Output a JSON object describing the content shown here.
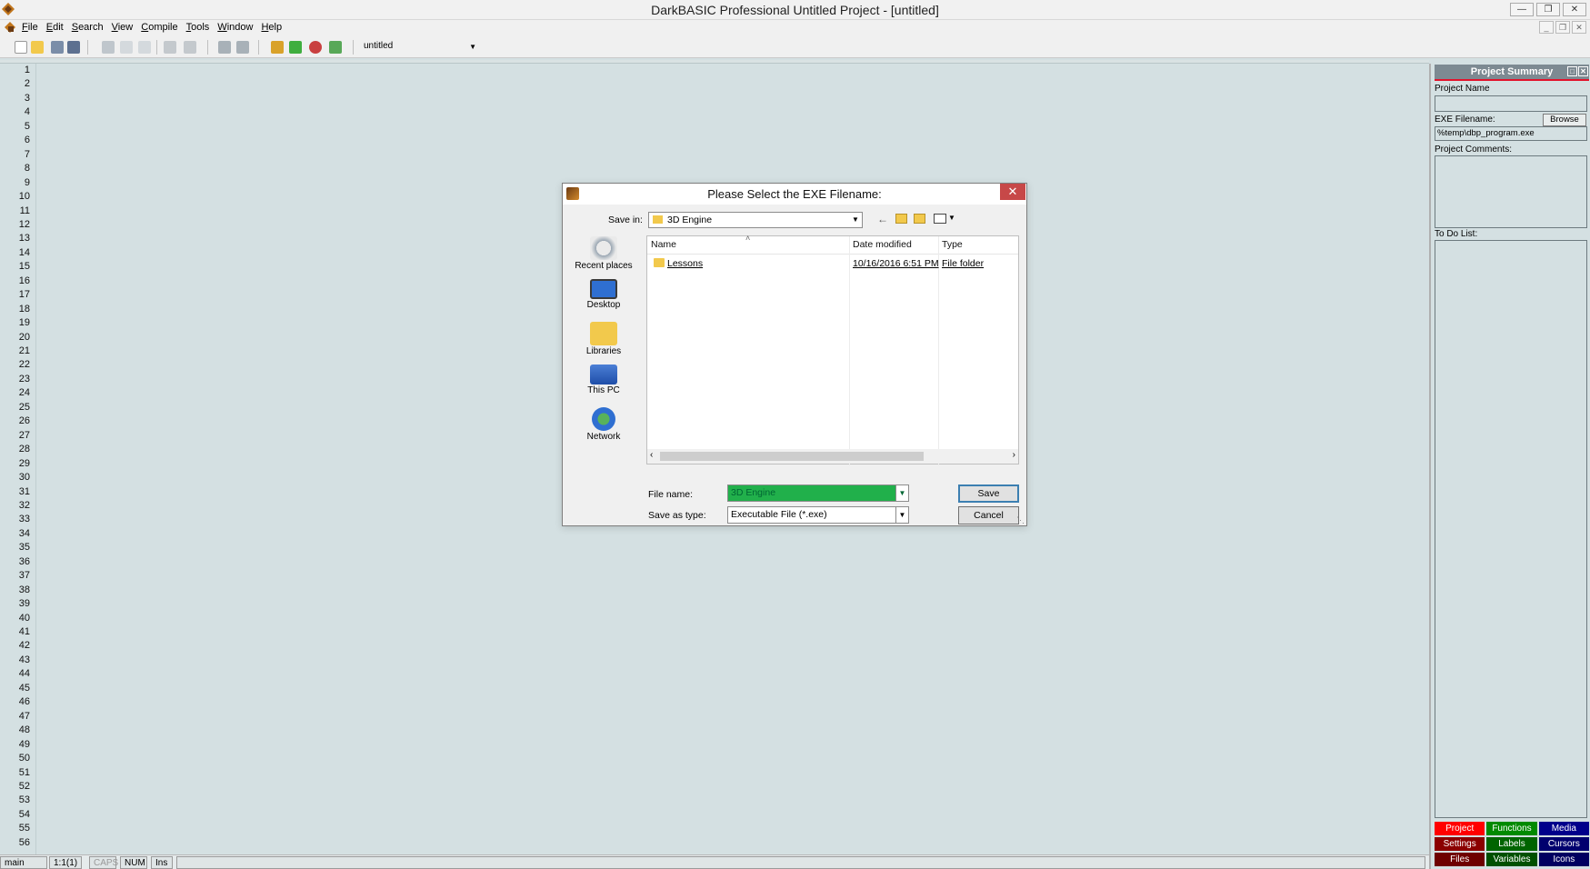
{
  "window": {
    "title": "DarkBASIC Professional  Untitled Project - [untitled]"
  },
  "menu": {
    "items": [
      "File",
      "Edit",
      "Search",
      "View",
      "Compile",
      "Tools",
      "Window",
      "Help"
    ]
  },
  "toolbar": {
    "combo_value": "untitled",
    "icons": [
      "new-file-icon",
      "open-file-icon",
      "save-icon",
      "save-all-icon",
      "cut-icon",
      "copy-icon",
      "paste-icon",
      "undo-icon",
      "redo-icon",
      "find-icon",
      "replace-icon",
      "make-exe-icon",
      "build-run-icon",
      "debug-icon",
      "step-icon"
    ]
  },
  "editor": {
    "line_numbers": [
      "1",
      "2",
      "3",
      "4",
      "5",
      "6",
      "7",
      "8",
      "9",
      "10",
      "11",
      "12",
      "13",
      "14",
      "15",
      "16",
      "17",
      "18",
      "19",
      "20",
      "21",
      "22",
      "23",
      "24",
      "25",
      "26",
      "27",
      "28",
      "29",
      "30",
      "31",
      "32",
      "33",
      "34",
      "35",
      "36",
      "37",
      "38",
      "39",
      "40",
      "41",
      "42",
      "43",
      "44",
      "45",
      "46",
      "47",
      "48",
      "49",
      "50",
      "51",
      "52",
      "53",
      "54",
      "55",
      "56"
    ]
  },
  "project_panel": {
    "title": "Project Summary",
    "project_name_label": "Project Name",
    "project_name_value": "",
    "exe_label": "EXE Filename:",
    "browse_label": "Browse",
    "exe_value": "%temp\\dbp_program.exe",
    "comments_label": "Project Comments:",
    "todo_label": "To Do List:",
    "tabs": [
      {
        "label": "Project",
        "color": "#ff0000"
      },
      {
        "label": "Functions",
        "color": "#008a00"
      },
      {
        "label": "Media",
        "color": "#00008b"
      },
      {
        "label": "Settings",
        "color": "#8b0000"
      },
      {
        "label": "Labels",
        "color": "#006400"
      },
      {
        "label": "Cursors",
        "color": "#00006e"
      },
      {
        "label": "Files",
        "color": "#6e0000"
      },
      {
        "label": "Variables",
        "color": "#005000"
      },
      {
        "label": "Icons",
        "color": "#000060"
      }
    ]
  },
  "statusbar": {
    "section": "main",
    "position": "1:1(1)",
    "caps": "CAPS",
    "num": "NUM",
    "ins": "Ins"
  },
  "dialog": {
    "title": "Please Select the EXE Filename:",
    "save_in_label": "Save in:",
    "save_in_value": "3D Engine",
    "places": [
      "Recent places",
      "Desktop",
      "Libraries",
      "This PC",
      "Network"
    ],
    "columns": {
      "name": "Name",
      "date": "Date modified",
      "type": "Type"
    },
    "files": [
      {
        "name": "Lessons",
        "date": "10/16/2016 6:51 PM",
        "type": "File folder"
      }
    ],
    "file_name_label": "File name:",
    "file_name_value": "3D Engine",
    "file_type_label": "Save as type:",
    "file_type_value": "Executable File (*.exe)",
    "save_button": "Save",
    "cancel_button": "Cancel",
    "accent_color": "#21b04b"
  }
}
